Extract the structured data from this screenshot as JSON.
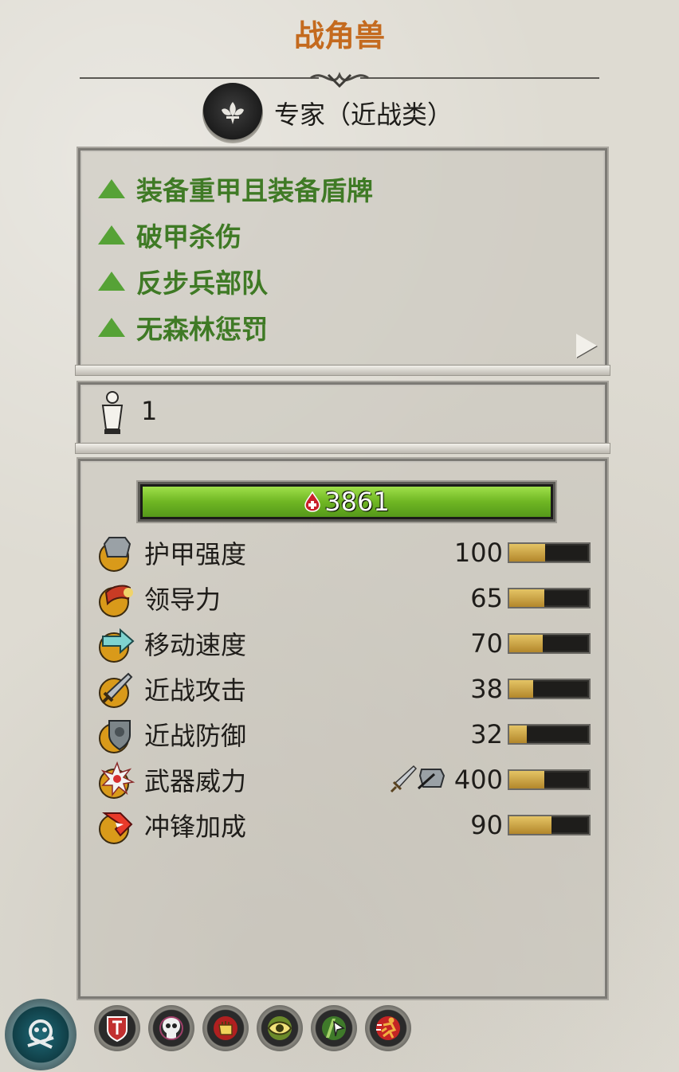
{
  "unit": {
    "title": "战角兽",
    "class_label": "专家（近战类）",
    "class_icon": "fleur-icon"
  },
  "traits": [
    {
      "label": "装备重甲且装备盾牌",
      "icon": "green-up-triangle-icon"
    },
    {
      "label": "破甲杀伤",
      "icon": "green-up-triangle-icon"
    },
    {
      "label": "反步兵部队",
      "icon": "green-up-triangle-icon"
    },
    {
      "label": "无森林惩罚",
      "icon": "green-up-triangle-icon"
    }
  ],
  "unit_count": {
    "icon": "soldier-icon",
    "value": "1"
  },
  "health": {
    "value": "3861",
    "fill": 1.0,
    "icon": "health-drop-icon"
  },
  "stats": [
    {
      "name": "护甲强度",
      "value": "100",
      "fill": 0.45,
      "icon": "armour-icon"
    },
    {
      "name": "领导力",
      "value": "65",
      "fill": 0.44,
      "icon": "leadership-icon"
    },
    {
      "name": "移动速度",
      "value": "70",
      "fill": 0.42,
      "icon": "speed-icon"
    },
    {
      "name": "近战攻击",
      "value": "38",
      "fill": 0.3,
      "icon": "melee-attack-icon"
    },
    {
      "name": "近战防御",
      "value": "32",
      "fill": 0.22,
      "icon": "melee-defence-icon"
    },
    {
      "name": "武器威力",
      "value": "400",
      "fill": 0.44,
      "icon": "weapon-strength-icon",
      "extra_icons": [
        "sword-icon",
        "armour-piercing-icon"
      ]
    },
    {
      "name": "冲锋加成",
      "value": "90",
      "fill": 0.53,
      "icon": "charge-bonus-icon"
    }
  ],
  "attribute_icons": [
    "wardstone-icon",
    "skull-icon",
    "fist-icon",
    "eye-icon",
    "cursor-icon",
    "runner-icon"
  ],
  "colors": {
    "title": "#c46a1e",
    "trait_text": "#3f7a25",
    "health_bar": "#6fb623",
    "stat_bar": "#c9a340"
  }
}
